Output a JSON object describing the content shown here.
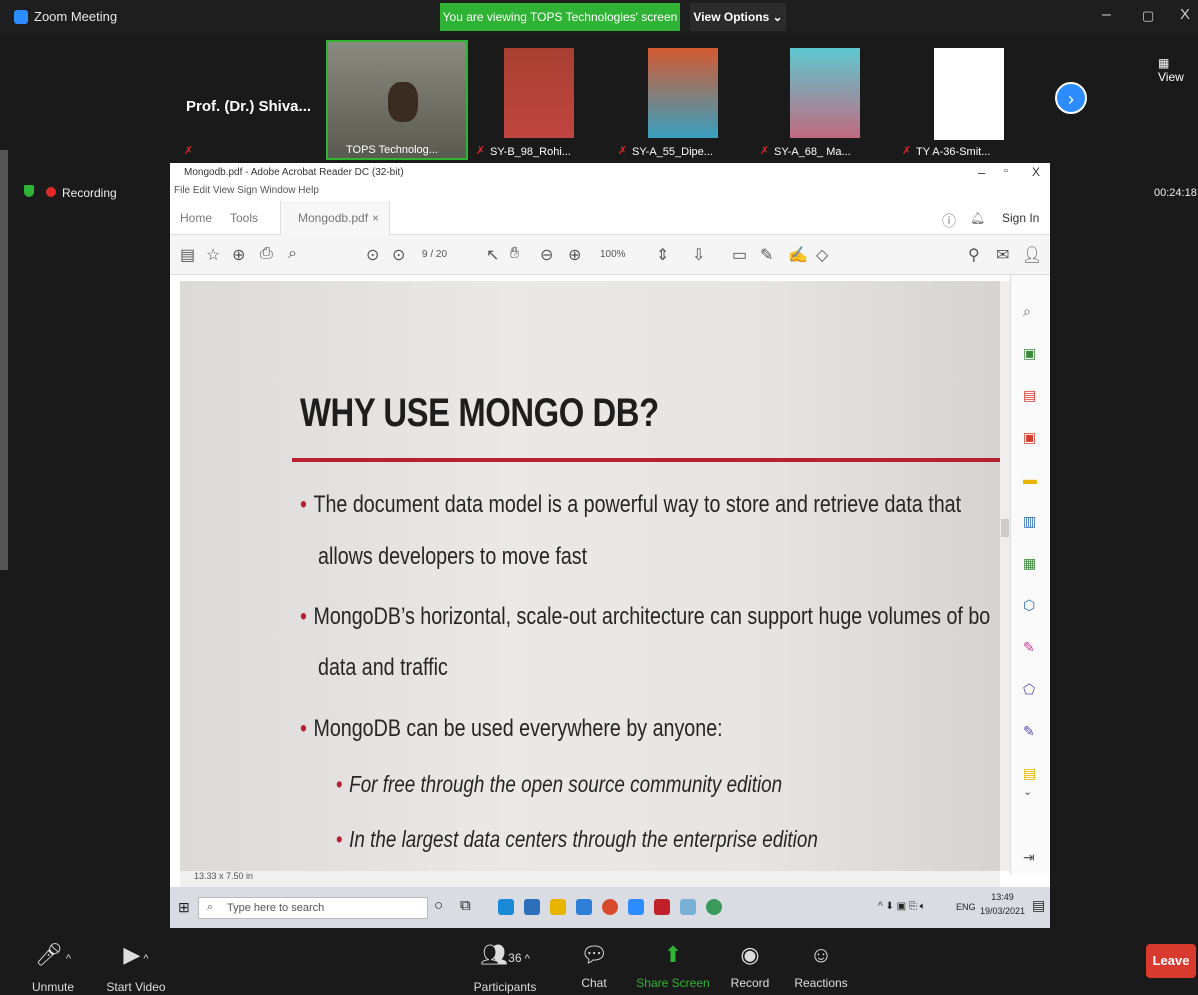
{
  "window": {
    "title": "Zoom Meeting"
  },
  "banner": {
    "viewing": "You are viewing TOPS Technologies' screen",
    "view_options": "View Options ⌄"
  },
  "participants": [
    {
      "name": "Prof. (Dr.) Shiva...",
      "label": ""
    },
    {
      "name": "",
      "label": "TOPS Technolog..."
    },
    {
      "name": "",
      "label": "SY-B_98_Rohi..."
    },
    {
      "name": "",
      "label": "SY-A_55_Dipe..."
    },
    {
      "name": "",
      "label": "SY-A_68_ Ma..."
    },
    {
      "name": "",
      "label": "TY A-36-Smit..."
    }
  ],
  "view_label": "View",
  "recording": {
    "label": "Recording"
  },
  "timer": "00:24:18",
  "acrobat": {
    "title": "Mongodb.pdf - Adobe Acrobat Reader DC (32-bit)",
    "menu": "File  Edit  View  Sign  Window  Help",
    "tabs": {
      "home": "Home",
      "tools": "Tools",
      "doc": "Mongodb.pdf"
    },
    "sign_in": "Sign In",
    "page_indicator": "9 / 20",
    "zoom": "100%",
    "status": "13.33 x 7.50 in"
  },
  "slide": {
    "title": "WHY USE MONGO DB?",
    "bullets": [
      "The document data model is a powerful way to store and retrieve data that",
      "allows developers to move fast",
      "MongoDB’s horizontal, scale-out architecture can support huge volumes of bo",
      "data and traffic",
      "MongoDB can be used everywhere by anyone:"
    ],
    "subbullets": [
      "For free through the open source community edition",
      "In the largest data centers through the enterprise edition"
    ]
  },
  "taskbar": {
    "search_placeholder": "Type here to search",
    "time": "13:49",
    "date": "19/03/2021",
    "lang": "ENG"
  },
  "controls": {
    "unmute": "Unmute",
    "start_video": "Start Video",
    "participants": "Participants",
    "participants_count": "36",
    "chat": "Chat",
    "share_screen": "Share Screen",
    "record": "Record",
    "reactions": "Reactions",
    "leave": "Leave"
  },
  "colors": {
    "accent": "#2d8cff",
    "banner": "#2fb334",
    "leave": "#d83a2e",
    "slide_rule": "#b8202f"
  }
}
